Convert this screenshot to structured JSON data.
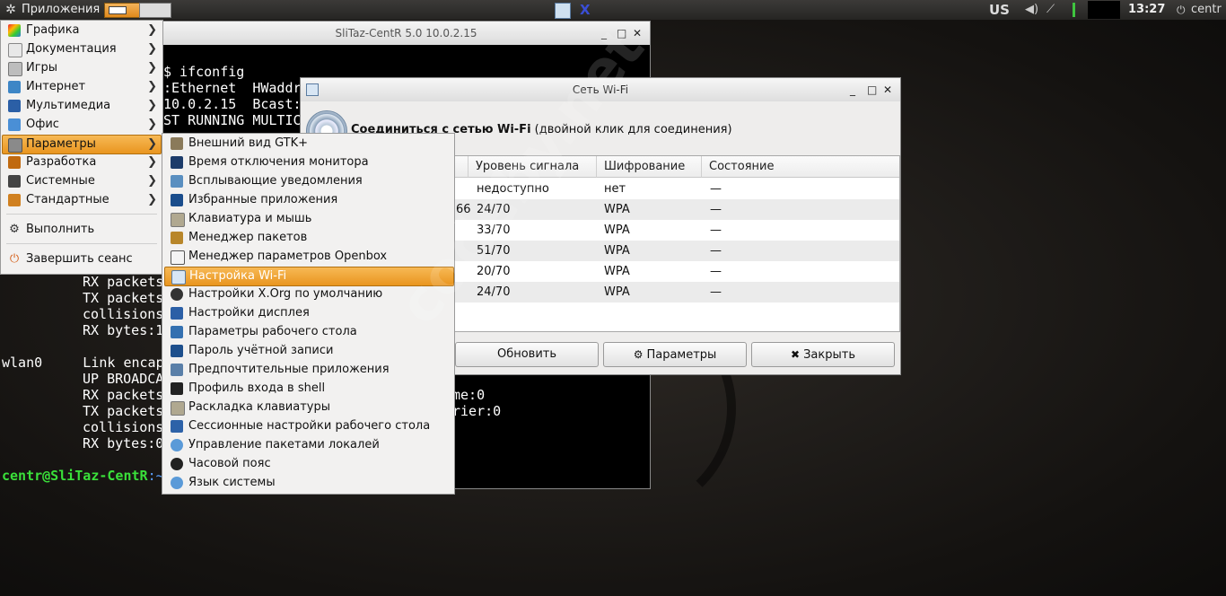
{
  "panel": {
    "apps_label": "Приложения",
    "kbd_layout": "US",
    "clock": "13:27",
    "username": "centr"
  },
  "terminal": {
    "title": "SliTaz-CentR 5.0 10.0.2.15",
    "lines": [
      "$ ifconfig",
      ":Ethernet  HWaddr",
      "10.0.2.15  Bcast:",
      "ST RUNNING MULTIC"
    ],
    "lower_lines": [
      "RX packets",
      "TX packets",
      "collisions",
      "RX bytes:1",
      "",
      "wlan0     Link encap",
      "UP BROADCA",
      "RX packets",
      "TX packets",
      "collisions",
      "RX bytes:0"
    ],
    "right_fragments": [
      "me:0",
      "rier:0"
    ],
    "prompt": "centr@SliTaz-CentR",
    "prompt_tail": ":~"
  },
  "app_menu": {
    "items": [
      {
        "label": "Графика",
        "icon": "graphics-icon",
        "color": "#3a7bd5"
      },
      {
        "label": "Документация",
        "icon": "documentation-icon",
        "color": "#cfcfcf"
      },
      {
        "label": "Игры",
        "icon": "games-icon",
        "color": "#9a9a9a"
      },
      {
        "label": "Интернет",
        "icon": "internet-icon",
        "color": "#3d86c6"
      },
      {
        "label": "Мультимедиа",
        "icon": "multimedia-icon",
        "color": "#2b5fa6"
      },
      {
        "label": "Офис",
        "icon": "office-icon",
        "color": "#4a8fd6"
      },
      {
        "label": "Параметры",
        "icon": "settings-icon",
        "color": "#8a8a8a"
      },
      {
        "label": "Разработка",
        "icon": "development-icon",
        "color": "#c06a10"
      },
      {
        "label": "Системные",
        "icon": "system-icon",
        "color": "#444444"
      },
      {
        "label": "Стандартные",
        "icon": "accessories-icon",
        "color": "#d08020"
      }
    ],
    "run_label": "Выполнить",
    "logout_label": "Завершить сеанс"
  },
  "sub_menu": {
    "items": [
      {
        "label": "Внешний вид GTK+",
        "icon": "gtk-appearance-icon",
        "color": "#8a7a5a"
      },
      {
        "label": "Время отключения монитора",
        "icon": "monitor-timeout-icon",
        "color": "#1d3c6a"
      },
      {
        "label": "Всплывающие уведомления",
        "icon": "notifications-icon",
        "color": "#5a8fc0"
      },
      {
        "label": "Избранные приложения",
        "icon": "favorites-icon",
        "color": "#1a4d8c"
      },
      {
        "label": "Клавиатура и мышь",
        "icon": "keyboard-mouse-icon",
        "color": "#b0a890"
      },
      {
        "label": "Менеджер пакетов",
        "icon": "package-manager-icon",
        "color": "#b8862a"
      },
      {
        "label": "Менеджер параметров Openbox",
        "icon": "openbox-settings-icon",
        "color": "#e8e8e8"
      },
      {
        "label": "Настройка Wi-Fi",
        "icon": "wifi-settings-icon",
        "color": "#d8e6f4"
      },
      {
        "label": "Настройки X.Org по умолчанию",
        "icon": "xorg-icon",
        "color": "#333333"
      },
      {
        "label": "Настройки дисплея",
        "icon": "display-settings-icon",
        "color": "#2b5fa6"
      },
      {
        "label": "Параметры рабочего стола",
        "icon": "desktop-settings-icon",
        "color": "#3470b0"
      },
      {
        "label": "Пароль учётной записи",
        "icon": "password-icon",
        "color": "#1d4f8c"
      },
      {
        "label": "Предпочтительные приложения",
        "icon": "preferred-apps-icon",
        "color": "#5a7fa8"
      },
      {
        "label": "Профиль входа в shell",
        "icon": "shell-profile-icon",
        "color": "#222222"
      },
      {
        "label": "Раскладка клавиатуры",
        "icon": "keyboard-layout-icon",
        "color": "#b0a890"
      },
      {
        "label": "Сессионные настройки рабочего стола",
        "icon": "session-settings-icon",
        "color": "#2d62a8"
      },
      {
        "label": "Управление пакетами локалей",
        "icon": "locale-packages-icon",
        "color": "#5a9ad8"
      },
      {
        "label": "Часовой пояс",
        "icon": "timezone-icon",
        "color": "#222222"
      },
      {
        "label": "Язык системы",
        "icon": "system-language-icon",
        "color": "#5a9ad8"
      }
    ],
    "active_index": 7
  },
  "wifi_dialog": {
    "title": "Сеть Wi-Fi",
    "header_bold": "Соединиться с сетью Wi-Fi",
    "header_note": "(двойной клик для соединения)",
    "columns": [
      "Уровень сигнала",
      "Шифрование",
      "Состояние"
    ],
    "rows": [
      {
        "ssid_tail": "",
        "signal": "недоступно",
        "enc": "нет",
        "state": "—"
      },
      {
        "ssid_tail": "66",
        "signal": "24/70",
        "enc": "WPA",
        "state": "—"
      },
      {
        "ssid_tail": "",
        "signal": "33/70",
        "enc": "WPA",
        "state": "—"
      },
      {
        "ssid_tail": "",
        "signal": "51/70",
        "enc": "WPA",
        "state": "—"
      },
      {
        "ssid_tail": "",
        "signal": "20/70",
        "enc": "WPA",
        "state": "—"
      },
      {
        "ssid_tail": "",
        "signal": "24/70",
        "enc": "WPA",
        "state": "—"
      }
    ],
    "buttons": {
      "refresh": "Обновить",
      "params": "Параметры",
      "close": "Закрыть"
    }
  },
  "watermark": "codeby.net"
}
